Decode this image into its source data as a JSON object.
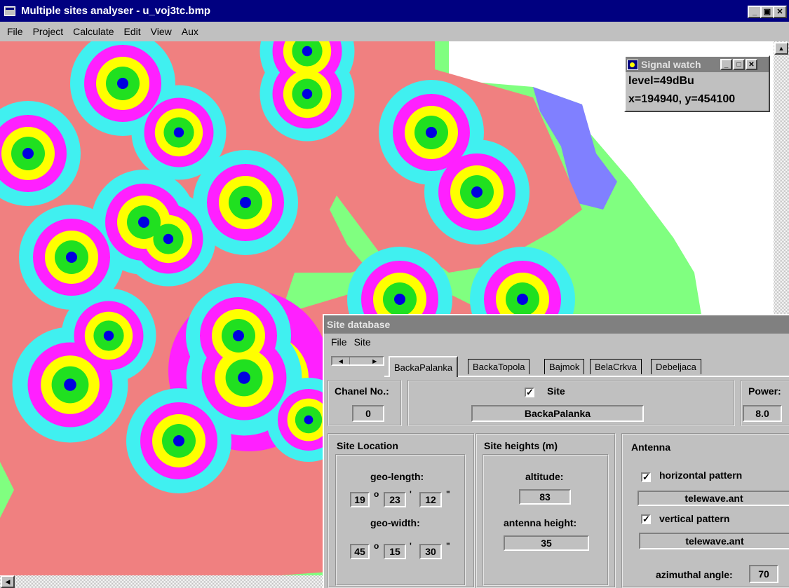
{
  "window": {
    "title": "Multiple sites analyser - u_voj3tc.bmp",
    "buttons": {
      "minimize": "_",
      "maximize": "▣",
      "close": "✕"
    }
  },
  "menu": [
    "File",
    "Project",
    "Calculate",
    "Edit",
    "View",
    "Aux"
  ],
  "signal_watch": {
    "title": "Signal watch",
    "level": "level=49dBu",
    "coords": "x=194940, y=454100"
  },
  "site_db": {
    "title": "Site database",
    "menu": [
      "File",
      "Site"
    ],
    "tabs": [
      "BackaPalanka",
      "BackaTopola",
      "Bajmok",
      "BelaCrkva",
      "Debeljaca"
    ],
    "active_tab": "BackaPalanka",
    "chanel_label": "Chanel No.:",
    "chanel_value": "0",
    "site_label": "Site",
    "site_checked": "✓",
    "site_value": "BackaPalanka",
    "power_label": "Power:",
    "power_value": "8.0",
    "location": {
      "title": "Site Location",
      "geo_length_label": "geo-length:",
      "geo_length": [
        "19",
        "23",
        "12"
      ],
      "geo_width_label": "geo-width:",
      "geo_width": [
        "45",
        "15",
        "30"
      ],
      "deg": "o",
      "min": "'",
      "sec": "\""
    },
    "heights": {
      "title": "Site heights (m)",
      "altitude_label": "altitude:",
      "altitude": "83",
      "antenna_height_label": "antenna height:",
      "antenna_height": "35"
    },
    "antenna": {
      "title": "Antenna",
      "hp_label": "horizontal pattern",
      "hp_checked": "✓",
      "hp_file": "telewave.ant",
      "vp_label": "vertical pattern",
      "vp_checked": "✓",
      "vp_file": "telewave.ant",
      "az_label": "azimuthal angle:",
      "az_value": "70"
    }
  },
  "colors": {
    "bg": "#f08080",
    "ring_cyan": "#40f0f0",
    "ring_magenta": "#ff20ff",
    "ring_yellow": "#ffff00",
    "ring_green": "#20e020",
    "center_blue": "#0000e0",
    "land_green": "#80ff80",
    "water_blue": "#8080ff"
  }
}
